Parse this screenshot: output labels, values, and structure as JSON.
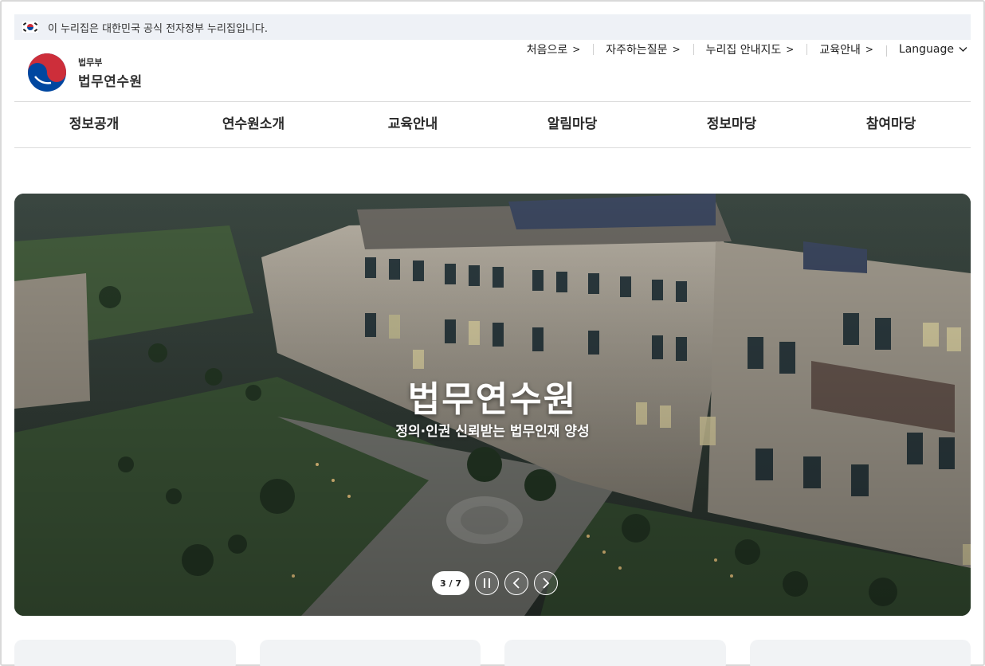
{
  "gov_banner": {
    "text": "이 누리집은 대한민국 공식 전자정부 누리집입니다.",
    "flag_icon": "korea-flag-icon"
  },
  "logo": {
    "ministry": "법무부",
    "name": "법무연수원",
    "emblem_icon": "government-emblem-icon"
  },
  "util_nav": [
    {
      "label": "처음으로",
      "icon": "chevron-right-icon"
    },
    {
      "label": "자주하는질문",
      "icon": "chevron-right-icon"
    },
    {
      "label": "누리집 안내지도",
      "icon": "chevron-right-icon"
    },
    {
      "label": "교육안내",
      "icon": "chevron-right-icon"
    },
    {
      "label": "Language",
      "icon": "chevron-down-icon"
    }
  ],
  "gnb": [
    "정보공개",
    "연수원소개",
    "교육안내",
    "알림마당",
    "정보마당",
    "참여마당"
  ],
  "hero": {
    "title": "법무연수원",
    "subtitle": "정의·인권 신뢰받는 법무인재 양성",
    "counter": "3 / 7",
    "pause_icon": "pause-icon",
    "prev_icon": "chevron-left-icon",
    "next_icon": "chevron-right-icon"
  },
  "colors": {
    "banner_bg": "#eef1f6",
    "text": "#222222",
    "divider": "#dcdcdc",
    "emblem_red": "#cd2e3a",
    "emblem_blue": "#0047a0"
  }
}
